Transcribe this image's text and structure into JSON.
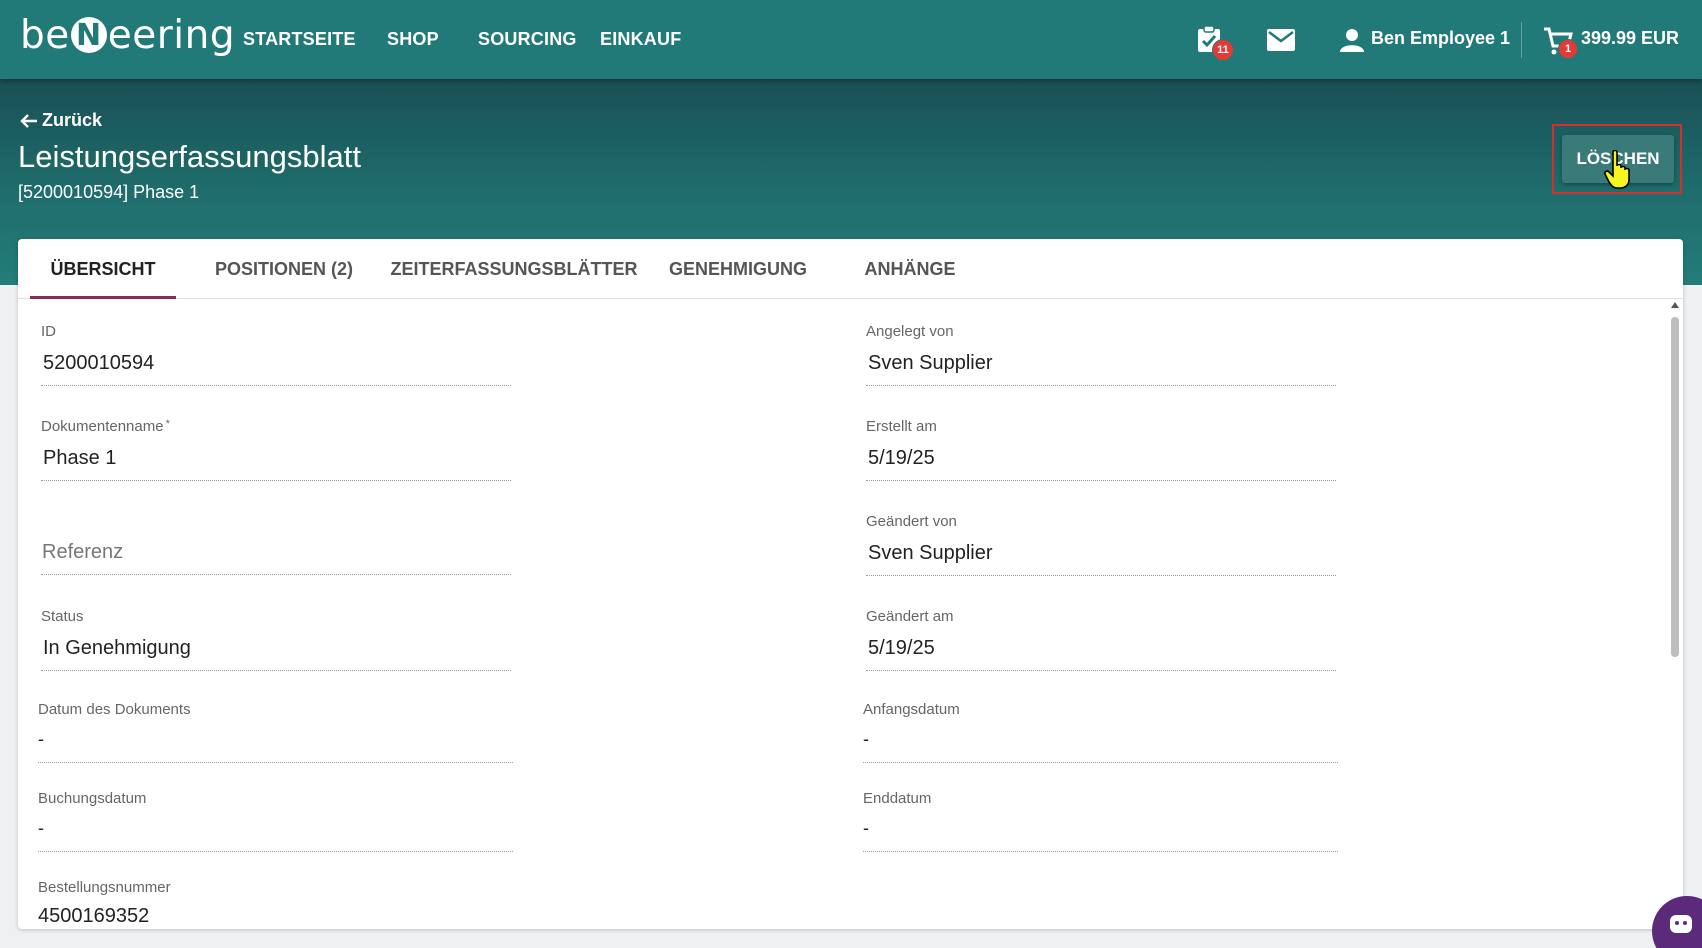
{
  "brand": {
    "logo_left": "be",
    "logo_n": "N",
    "logo_right": "eering"
  },
  "nav": {
    "items": [
      "STARTSEITE",
      "SHOP",
      "SOURCING",
      "EINKAUF"
    ]
  },
  "header": {
    "tasks_badge": "11",
    "user_name": "Ben Employee 1",
    "cart_badge": "1",
    "cart_total": "399.99 EUR"
  },
  "page": {
    "back_label": "Zurück",
    "title": "Leistungserfassungsblatt",
    "subtitle": "[5200010594] Phase 1",
    "delete_label": "LÖSCHEN"
  },
  "tabs": [
    {
      "label": "ÜBERSICHT",
      "active": true
    },
    {
      "label": "POSITIONEN (2)",
      "active": false
    },
    {
      "label": "ZEITERFASSUNGSBLÄTTER",
      "active": false
    },
    {
      "label": "GENEHMIGUNG",
      "active": false
    },
    {
      "label": "ANHÄNGE",
      "active": false
    }
  ],
  "fields": {
    "id": {
      "label": "ID",
      "value": "5200010594"
    },
    "document_name": {
      "label": "Dokumentenname",
      "required_mark": "*",
      "value": "Phase 1"
    },
    "reference": {
      "placeholder": "Referenz"
    },
    "status": {
      "label": "Status",
      "value": "In Genehmigung"
    },
    "document_date": {
      "label": "Datum des Dokuments",
      "value": "-"
    },
    "posting_date": {
      "label": "Buchungsdatum",
      "value": "-"
    },
    "order_number": {
      "label": "Bestellungsnummer",
      "value": "4500169352"
    },
    "created_by": {
      "label": "Angelegt von",
      "value": "Sven Supplier"
    },
    "created_on": {
      "label": "Erstellt am",
      "value": "5/19/25"
    },
    "changed_by": {
      "label": "Geändert von",
      "value": "Sven Supplier"
    },
    "changed_on": {
      "label": "Geändert am",
      "value": "5/19/25"
    },
    "start_date": {
      "label": "Anfangsdatum",
      "value": "-"
    },
    "end_date": {
      "label": "Enddatum",
      "value": "-"
    }
  },
  "colors": {
    "header_bg": "#227a78",
    "accent_tab": "#8a2b56",
    "badge": "#e53935",
    "highlight": "#d32f2f"
  }
}
